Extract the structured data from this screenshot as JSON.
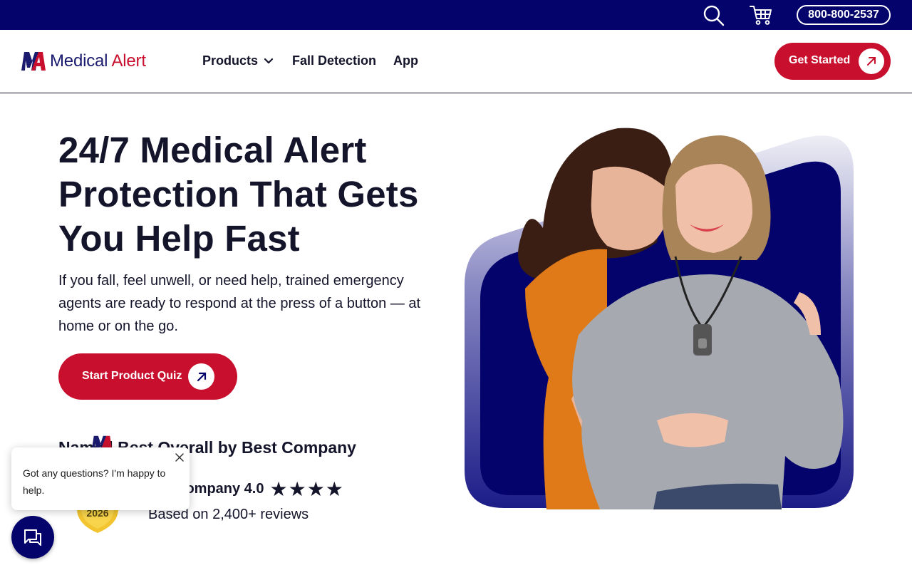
{
  "topbar": {
    "phone": "800-800-2537",
    "icons": [
      "search-icon",
      "cart-icon"
    ]
  },
  "nav": {
    "logo_text_1": "Medical",
    "logo_text_2": "Alert",
    "items": [
      {
        "label": "Products"
      },
      {
        "label": "Fall Detection"
      },
      {
        "label": "App"
      }
    ],
    "cta_label": "Get Started"
  },
  "hero": {
    "title_line_1": "24/7 Medical Alert",
    "title_line_2": "Protection That Gets",
    "title_line_3": "You Help Fast",
    "subtitle": "If you fall, feel unwell, or need help, trained emergency agents are ready to respond at the press of a button — at home or on the go.",
    "quiz_label": "Start Product Quiz"
  },
  "award": {
    "heading": "Named Best Overall by Best Company",
    "badge_year": "2026",
    "rating_label": "Company 4.0",
    "stars": "★★★★",
    "reviews": "Based on 2,400+ reviews"
  },
  "chat": {
    "message": "Got any questions? I'm happy to help."
  },
  "colors": {
    "navy": "#03036b",
    "brand_red": "#c8102e",
    "text": "#14142b"
  }
}
